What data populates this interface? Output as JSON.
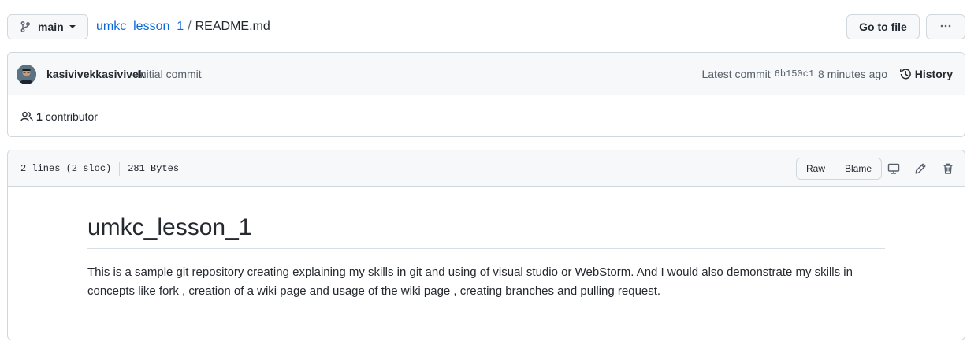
{
  "topbar": {
    "branch": "main",
    "repo": "umkc_lesson_1",
    "separator": "/",
    "file": "README.md",
    "goto_file": "Go to file",
    "more": "···"
  },
  "commit": {
    "author": "kasivivekkasivivek",
    "message": "Initial commit",
    "latest_label": "Latest commit",
    "sha": "6b150c1",
    "time": "8 minutes ago",
    "history": "History"
  },
  "contributors": {
    "count": "1",
    "label": "contributor"
  },
  "file": {
    "lines": "2 lines (2 sloc)",
    "size": "281 Bytes",
    "raw": "Raw",
    "blame": "Blame"
  },
  "readme": {
    "title": "umkc_lesson_1",
    "body": "This is a sample git repository creating explaining my skills in git and using of visual studio or WebStorm. And I would also demonstrate my skills in concepts like fork , creation of a wiki page and usage of the wiki page , creating branches and pulling request."
  },
  "icons": {
    "branch": "git-branch-icon",
    "kebab": "kebab-horizontal-icon",
    "history": "history-icon",
    "people": "people-icon",
    "display": "desktop-icon",
    "edit": "pencil-icon",
    "delete": "trash-icon"
  },
  "colors": {
    "link": "#0969da",
    "border": "#d0d7de",
    "header_bg": "#f6f8fa",
    "muted": "#57606a"
  }
}
